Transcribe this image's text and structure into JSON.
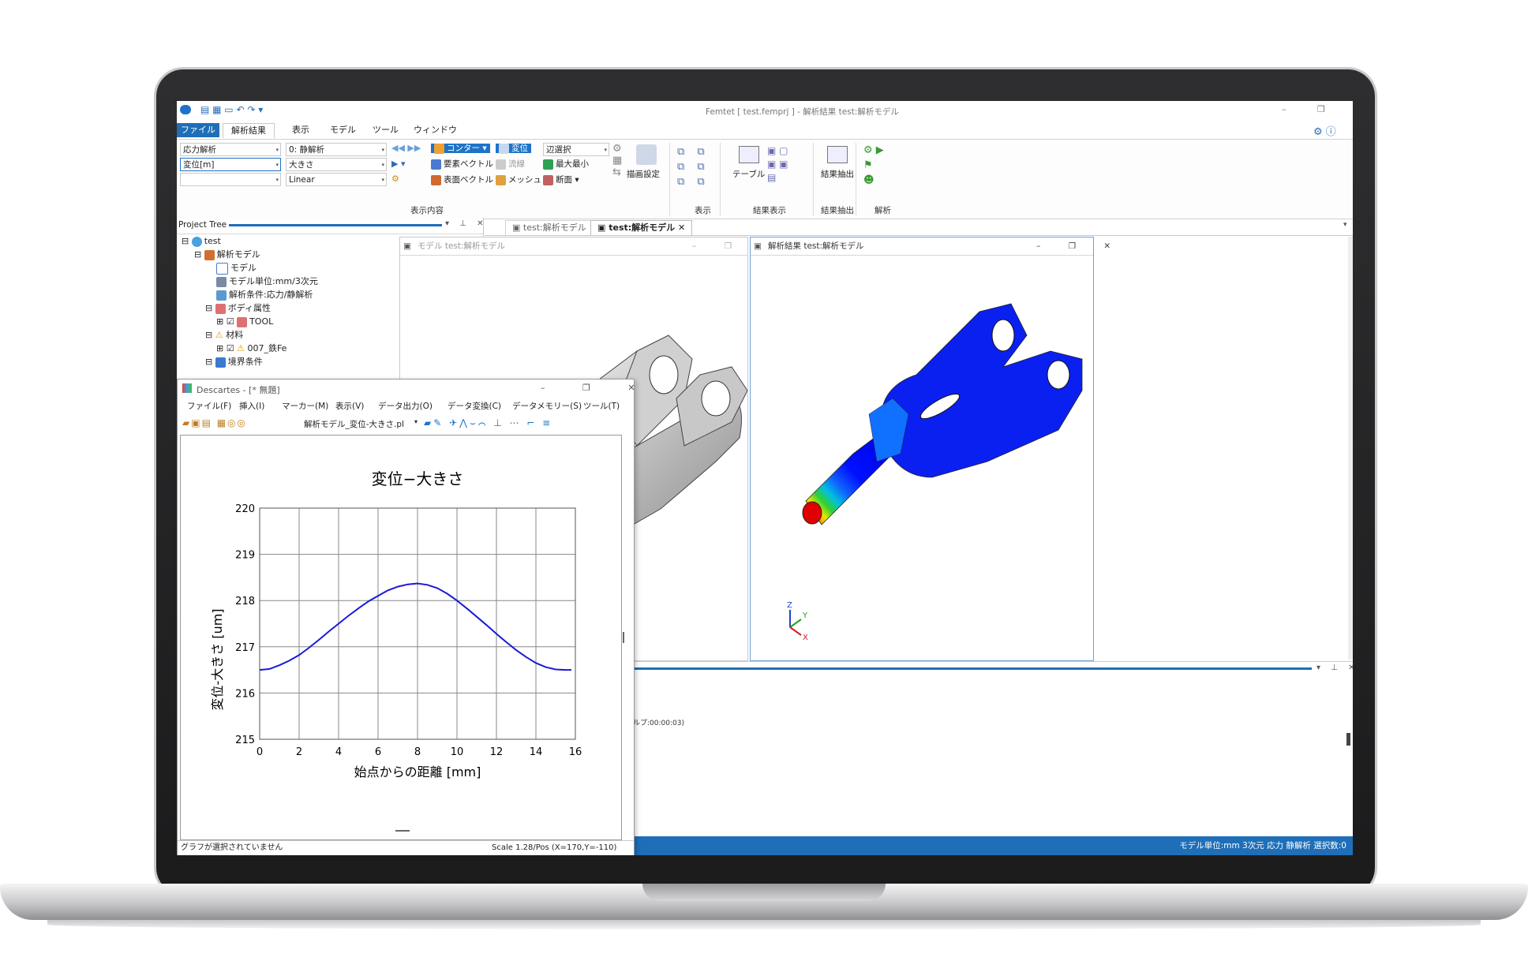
{
  "app": {
    "title": "Femtet [ test.femprj ] - 解析結果 test:解析モデル",
    "ribbon_tabs": [
      "ファイル",
      "解析結果",
      "表示",
      "モデル",
      "ツール",
      "ウィンドウ"
    ],
    "combos": {
      "analysis": "応力解析",
      "step": "0: 静解析",
      "quantity": "変位[m]",
      "component": "大きさ",
      "scale": "Linear"
    },
    "buttons": {
      "contour": "コンター",
      "element_vector": "要素ベクトル",
      "surface_vector": "表面ベクトル",
      "deform": "変位",
      "flow": "流線",
      "mesh": "メッシュ",
      "edge_select": "辺選択",
      "max_min": "最大最小",
      "section": "断面",
      "draw_settings": "描画設定",
      "table": "テーブル",
      "extract": "結果抽出"
    },
    "groups": [
      "表示内容",
      "表示",
      "結果表示",
      "結果抽出",
      "解析"
    ],
    "tree_title": "Project Tree",
    "tree": [
      "test",
      "解析モデル",
      "モデル",
      "モデル単位:mm/3次元",
      "解析条件:応力/静解析",
      "ボディ属性",
      "TOOL",
      "材料",
      "007_鉄Fe",
      "境界条件"
    ],
    "doc_tabs": [
      "test:解析モデル",
      "test:解析モデル"
    ],
    "pane_titles": {
      "model": "モデル test:解析モデル",
      "result": "解析結果 test:解析モデル"
    },
    "log_fragment": "ルプ:00:00:03)",
    "statusbar": "モデル単位:mm 3次元 応力 静解析 選択数:0",
    "axes_labels": [
      "Z",
      "Y",
      "X"
    ]
  },
  "descartes": {
    "title": "Descartes - [* 無題]",
    "menu": [
      "ファイル(F)",
      "挿入(I)",
      "マーカー(M)",
      "表示(V)",
      "データ出力(O)",
      "データ変換(C)",
      "データメモリー(S)",
      "ツール(T)"
    ],
    "toolbar_file": "解析モデル_変位-大きさ.pl",
    "status_left": "グラフが選択されていません",
    "status_right": "Scale 1.28/Pos (X=170,Y=-110)"
  },
  "chart_data": {
    "type": "line",
    "title": "変位−大きさ",
    "xlabel": "始点からの距離 [mm]",
    "ylabel": "変位-大きさ [um]",
    "xlim": [
      0,
      16
    ],
    "ylim": [
      215,
      220
    ],
    "xticks": [
      0,
      2,
      4,
      6,
      8,
      10,
      12,
      14,
      16
    ],
    "yticks": [
      215,
      216,
      217,
      218,
      219,
      220
    ],
    "grid": true,
    "series": [
      {
        "color": "#1a1ad8",
        "x": [
          0,
          0.5,
          1,
          1.5,
          2,
          2.5,
          3,
          3.5,
          4,
          4.5,
          5,
          5.5,
          6,
          6.5,
          7,
          7.5,
          8,
          8.5,
          9,
          9.5,
          10,
          10.5,
          11,
          11.5,
          12,
          12.5,
          13,
          13.5,
          14,
          14.5,
          15,
          15.5,
          15.8
        ],
        "y": [
          216.5,
          216.52,
          216.6,
          216.7,
          216.82,
          216.98,
          217.15,
          217.33,
          217.5,
          217.67,
          217.83,
          217.98,
          218.1,
          218.22,
          218.3,
          218.35,
          218.37,
          218.34,
          218.27,
          218.15,
          218.0,
          217.83,
          217.65,
          217.47,
          217.28,
          217.1,
          216.93,
          216.78,
          216.65,
          216.56,
          216.51,
          216.5,
          216.5
        ]
      }
    ]
  }
}
